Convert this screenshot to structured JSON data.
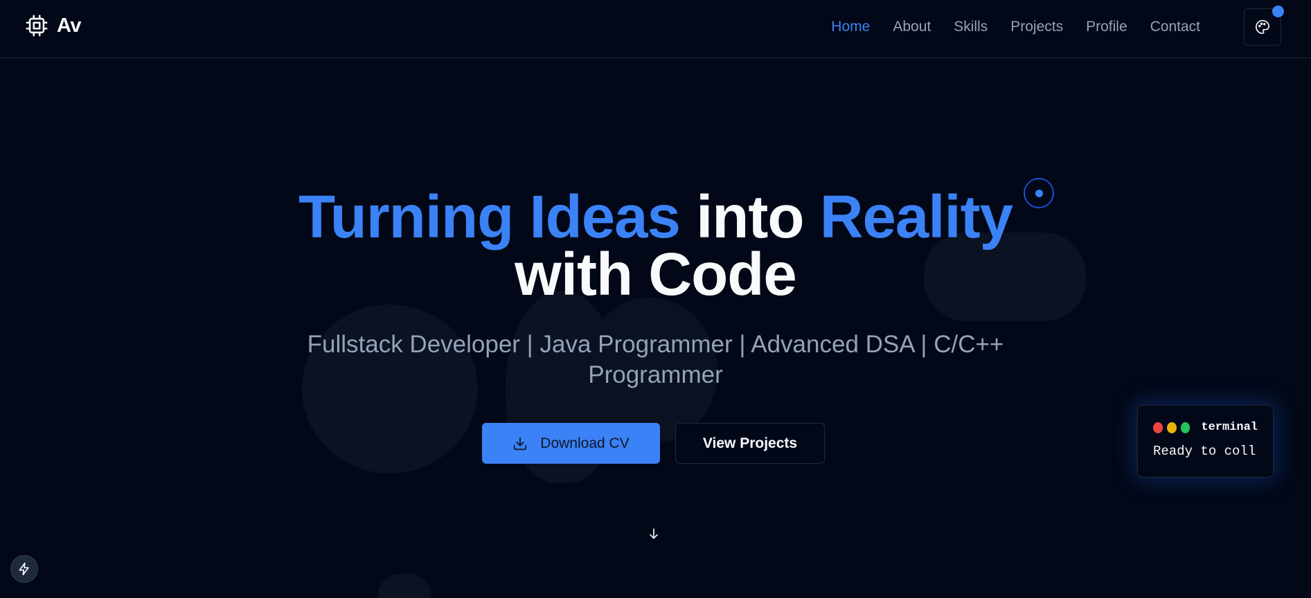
{
  "brand": {
    "text": "Av",
    "icon": "cpu-chip-icon"
  },
  "nav": {
    "items": [
      {
        "label": "Home",
        "active": true
      },
      {
        "label": "About",
        "active": false
      },
      {
        "label": "Skills",
        "active": false
      },
      {
        "label": "Projects",
        "active": false
      },
      {
        "label": "Profile",
        "active": false
      },
      {
        "label": "Contact",
        "active": false
      }
    ],
    "theme_icon": "palette-icon"
  },
  "hero": {
    "title_part1": "Turning Ideas",
    "title_part2": "into",
    "title_part3": "Reality",
    "title_part4": "with Code",
    "subtitle": "Fullstack Developer | Java Programmer | Advanced DSA | C/C++ Programmer",
    "primary_button": "Download CV",
    "primary_icon": "download-icon",
    "secondary_button": "View Projects",
    "scroll_icon": "arrow-down-icon"
  },
  "terminal": {
    "title": "terminal",
    "text": "Ready to coll"
  },
  "fab": {
    "icon": "lightning-bolt-icon"
  },
  "colors": {
    "background": "#020817",
    "accent": "#3b82f6",
    "muted_text": "#94a3b8",
    "text": "#f8fafc"
  }
}
